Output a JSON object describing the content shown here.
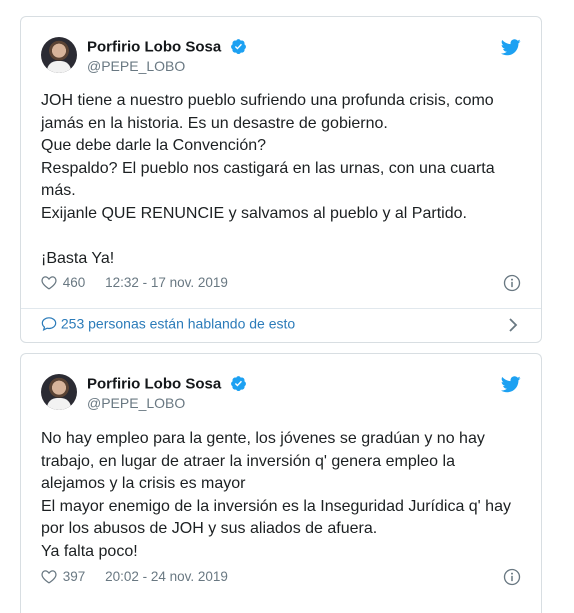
{
  "tweets": [
    {
      "author_name": "Porfirio Lobo Sosa",
      "handle": "@PEPE_LOBO",
      "lines": [
        "JOH tiene a nuestro pueblo sufriendo una profunda crisis, como jamás en la historia. Es un desastre de gobierno.",
        "Que debe darle la Convención?",
        "Respaldo? El pueblo nos castigará en las urnas, con una cuarta más.",
        "Exijanle QUE RENUNCIE y salvamos al pueblo y al Partido.",
        "",
        "¡Basta Ya!"
      ],
      "likes": "460",
      "timestamp": "12:32 - 17 nov. 2019",
      "conversation": "253 personas están hablando de esto"
    },
    {
      "author_name": "Porfirio Lobo Sosa",
      "handle": "@PEPE_LOBO",
      "lines": [
        "No hay empleo para la gente, los jóvenes se gradúan y no hay trabajo, en lugar de atraer la inversión q' genera empleo la alejamos y la crisis es mayor",
        "El mayor enemigo de la inversión es la Inseguridad Jurídica q' hay por los abusos de JOH y sus aliados de afuera.",
        "Ya falta poco!"
      ],
      "likes": "397",
      "timestamp": "20:02 - 24 nov. 2019"
    }
  ],
  "colors": {
    "twitter_blue": "#1da1f2",
    "link_blue": "#2b7bb9",
    "meta_gray": "#697882"
  },
  "icons": [
    "verified-badge-icon",
    "twitter-bird-icon",
    "heart-icon",
    "info-icon",
    "speech-bubble-icon",
    "chevron-right-icon"
  ]
}
